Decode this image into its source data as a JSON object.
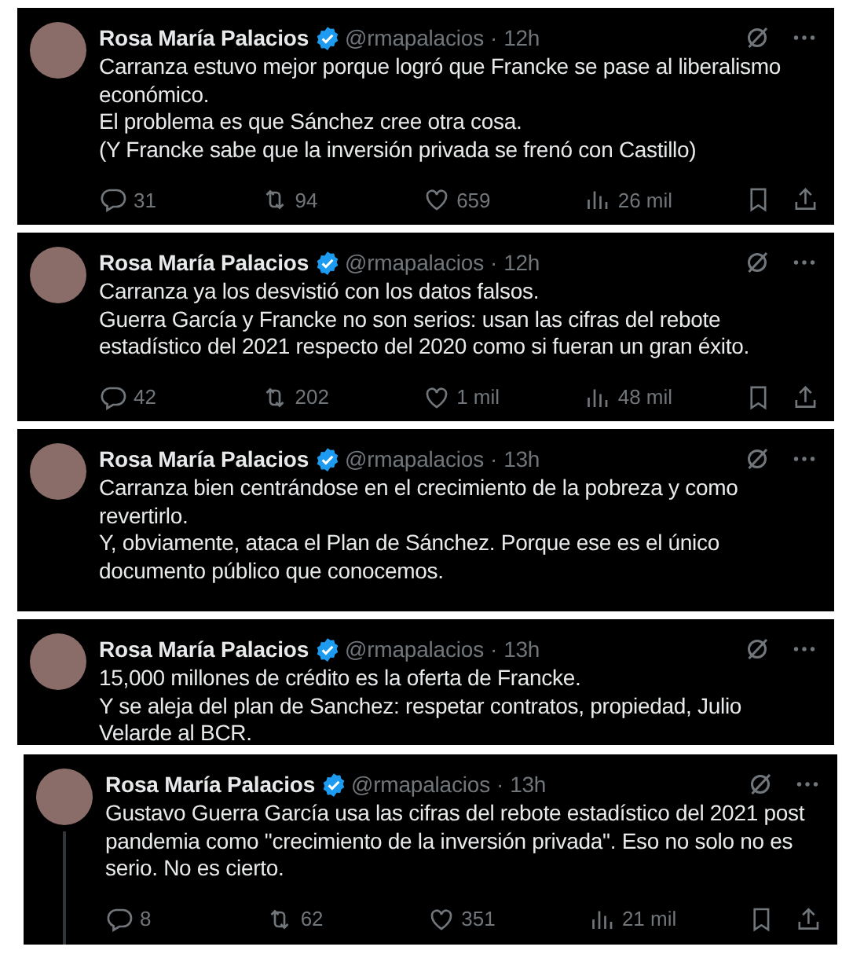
{
  "tweets": [
    {
      "name": "Rosa María Palacios",
      "handle": "@rmapalacios",
      "separator": "·",
      "time": "12h",
      "verified": true,
      "thread_line": false,
      "paragraphs": [
        "Carranza estuvo mejor porque logró que Francke se pase al liberalismo económico.",
        "El problema es que Sánchez cree otra cosa.",
        "(Y Francke sabe que la inversión privada se frenó con Castillo)"
      ],
      "stats": {
        "replies": "31",
        "reposts": "94",
        "likes": "659",
        "views": "26 mil"
      }
    },
    {
      "name": "Rosa María Palacios",
      "handle": "@rmapalacios",
      "separator": "·",
      "time": "12h",
      "verified": true,
      "thread_line": false,
      "paragraphs": [
        "Carranza ya los desvistió con los datos falsos.",
        "Guerra García y Francke no son serios: usan las cifras del rebote estadístico del 2021 respecto del 2020 como si fueran un gran éxito."
      ],
      "stats": {
        "replies": "42",
        "reposts": "202",
        "likes": "1 mil",
        "views": "48 mil"
      }
    },
    {
      "name": "Rosa María Palacios",
      "handle": "@rmapalacios",
      "separator": "·",
      "time": "13h",
      "verified": true,
      "thread_line": false,
      "paragraphs": [
        "Carranza bien centrándose en el crecimiento de la pobreza y como revertirlo.",
        "Y, obviamente, ataca el Plan de Sánchez. Porque ese es el único documento público que conocemos."
      ]
    },
    {
      "name": "Rosa María Palacios",
      "handle": "@rmapalacios",
      "separator": "·",
      "time": "13h",
      "verified": true,
      "thread_line": false,
      "paragraphs": [
        "15,000 millones de crédito es la oferta de Francke.",
        "Y se aleja del plan de Sanchez: respetar contratos, propiedad, Julio Velarde al BCR."
      ]
    },
    {
      "name": "Rosa María Palacios",
      "handle": "@rmapalacios",
      "separator": "·",
      "time": "13h",
      "verified": true,
      "thread_line": true,
      "paragraphs": [
        "Gustavo Guerra García usa las cifras del rebote estadístico del 2021 post pandemia como \"crecimiento de la inversión privada\". Eso no solo no es serio. No es cierto."
      ],
      "stats": {
        "replies": "8",
        "reposts": "62",
        "likes": "351",
        "views": "21 mil"
      }
    }
  ]
}
